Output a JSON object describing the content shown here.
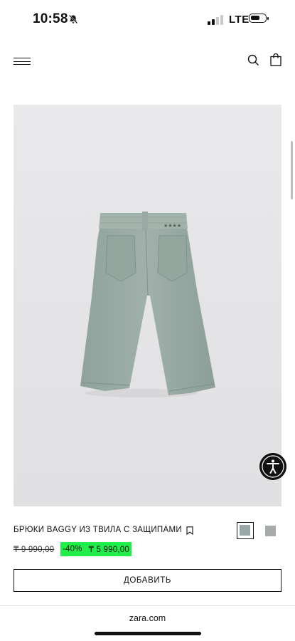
{
  "status_bar": {
    "time": "10:58",
    "network": "LTE"
  },
  "header": {
    "menu_icon": "hamburger-menu-icon",
    "search_icon": "search-icon",
    "bag_icon": "shopping-bag-icon"
  },
  "product": {
    "title": "БРЮКИ BAGGY ИЗ ТВИЛА С ЗАЩИПАМИ",
    "old_price": "₸ 9 990,00",
    "discount": "-40%",
    "new_price": "₸ 5 990,00",
    "add_button_label": "ДОБАВИТЬ",
    "colors": [
      {
        "hex": "#9aa7a7",
        "selected": true
      },
      {
        "hex": "#a7abab",
        "selected": false
      }
    ],
    "discount_bg": "#22ee4a"
  },
  "footer": {
    "url": "zara.com"
  }
}
